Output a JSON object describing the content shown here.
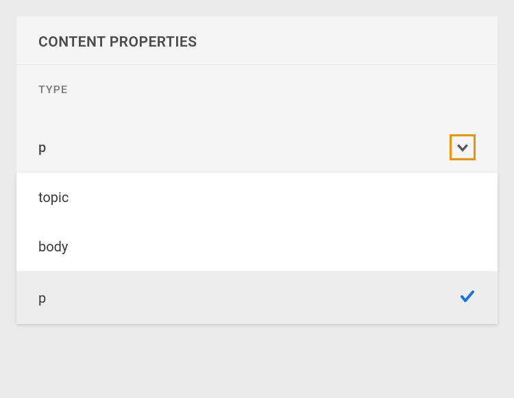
{
  "panel": {
    "title": "CONTENT PROPERTIES"
  },
  "section": {
    "label": "TYPE"
  },
  "select": {
    "value": "p"
  },
  "options": {
    "0": {
      "label": "topic"
    },
    "1": {
      "label": "body"
    },
    "2": {
      "label": "p"
    }
  }
}
